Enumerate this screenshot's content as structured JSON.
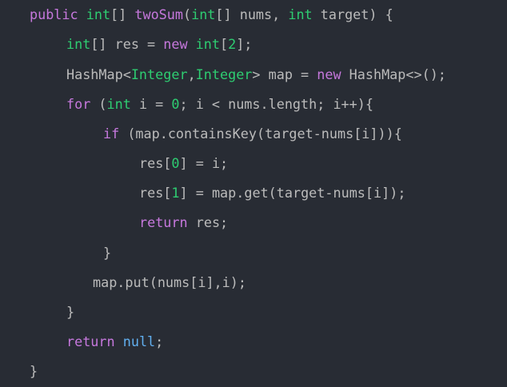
{
  "colors": {
    "background": "#282c34",
    "default": "#bbbbbb",
    "keyword": "#c678dd",
    "type": "#2ecc71",
    "function": "#c678dd",
    "number": "#2ecc71",
    "null": "#61afef"
  },
  "code_lines": [
    [
      {
        "t": "public ",
        "k": "keyword"
      },
      {
        "t": "int",
        "k": "type"
      },
      {
        "t": "[] ",
        "k": "default"
      },
      {
        "t": "twoSum",
        "k": "function"
      },
      {
        "t": "(",
        "k": "default"
      },
      {
        "t": "int",
        "k": "type"
      },
      {
        "t": "[] nums, ",
        "k": "default"
      },
      {
        "t": "int",
        "k": "type"
      },
      {
        "t": " target) {",
        "k": "default"
      }
    ],
    [
      {
        "t": "int",
        "k": "type"
      },
      {
        "t": "[] res = ",
        "k": "default"
      },
      {
        "t": "new ",
        "k": "keyword"
      },
      {
        "t": "int",
        "k": "type"
      },
      {
        "t": "[",
        "k": "default"
      },
      {
        "t": "2",
        "k": "number"
      },
      {
        "t": "];",
        "k": "default"
      }
    ],
    [
      {
        "t": "HashMap<",
        "k": "default"
      },
      {
        "t": "Integer",
        "k": "type"
      },
      {
        "t": ",",
        "k": "default"
      },
      {
        "t": "Integer",
        "k": "type"
      },
      {
        "t": "> map = ",
        "k": "default"
      },
      {
        "t": "new ",
        "k": "keyword"
      },
      {
        "t": "HashMap<>();",
        "k": "default"
      }
    ],
    [
      {
        "t": "for ",
        "k": "keyword"
      },
      {
        "t": "(",
        "k": "default"
      },
      {
        "t": "int",
        "k": "type"
      },
      {
        "t": " i = ",
        "k": "default"
      },
      {
        "t": "0",
        "k": "number"
      },
      {
        "t": "; i < nums.length; i++){",
        "k": "default"
      }
    ],
    [
      {
        "t": "if ",
        "k": "keyword"
      },
      {
        "t": "(map.containsKey(target-nums[i])){",
        "k": "default"
      }
    ],
    [
      {
        "t": "res[",
        "k": "default"
      },
      {
        "t": "0",
        "k": "number"
      },
      {
        "t": "] = i;",
        "k": "default"
      }
    ],
    [
      {
        "t": "res[",
        "k": "default"
      },
      {
        "t": "1",
        "k": "number"
      },
      {
        "t": "] = map.get(target-nums[i]);",
        "k": "default"
      }
    ],
    [
      {
        "t": "return ",
        "k": "keyword"
      },
      {
        "t": "res;",
        "k": "default"
      }
    ],
    [
      {
        "t": "}",
        "k": "default"
      }
    ],
    [
      {
        "t": "map.put(nums[i],i);",
        "k": "default"
      }
    ],
    [
      {
        "t": "}",
        "k": "default"
      }
    ],
    [
      {
        "t": "return ",
        "k": "keyword"
      },
      {
        "t": "null",
        "k": "null"
      },
      {
        "t": ";",
        "k": "default"
      }
    ],
    [
      {
        "t": "}",
        "k": "default"
      }
    ]
  ]
}
